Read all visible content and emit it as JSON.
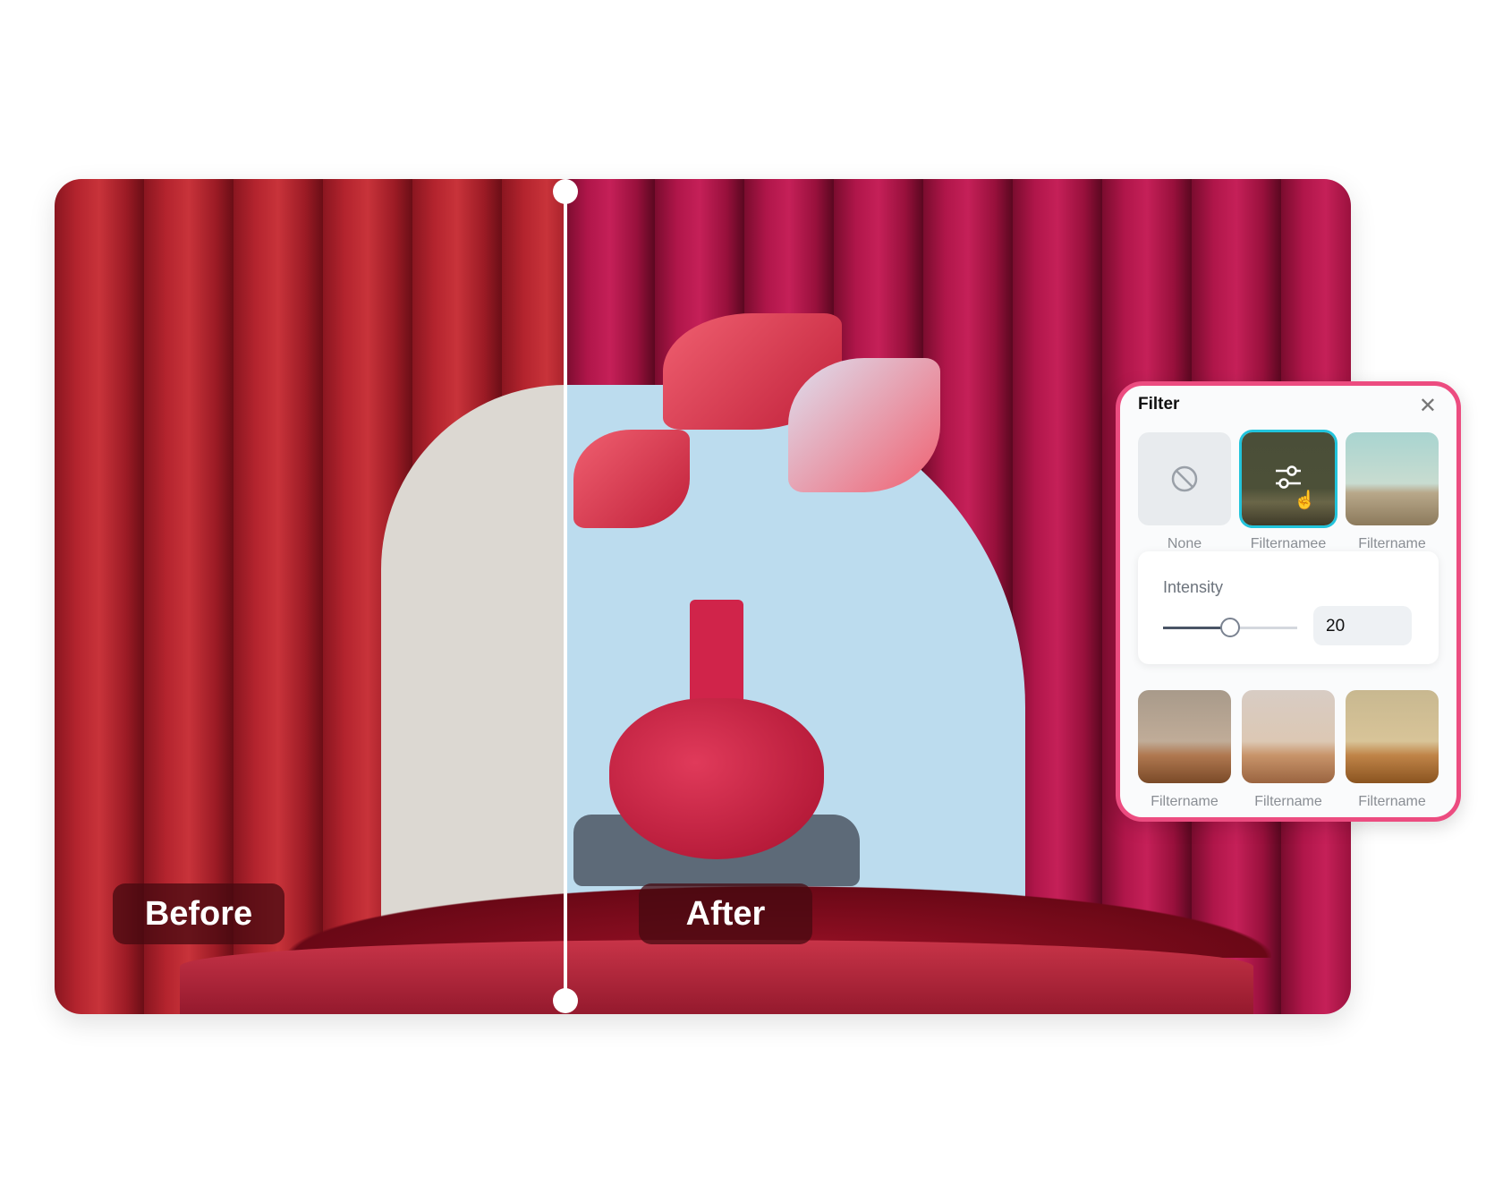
{
  "comparison": {
    "before_label": "Before",
    "after_label": "After"
  },
  "filter_panel": {
    "title": "Filter",
    "close_icon": "close-icon",
    "filters": [
      {
        "name": "None",
        "icon": "no-symbol-icon"
      },
      {
        "name": "Filternamee",
        "selected": true,
        "icon": "sliders-icon"
      },
      {
        "name": "Filtername"
      },
      {
        "name": "Filtername"
      },
      {
        "name": "Filtername"
      },
      {
        "name": "Filtername"
      }
    ],
    "intensity": {
      "label": "Intensity",
      "value": "20",
      "slider_fraction": 0.5
    },
    "colors": {
      "accent_border": "#ec4c80",
      "selected_ring": "#22c4dc"
    }
  }
}
